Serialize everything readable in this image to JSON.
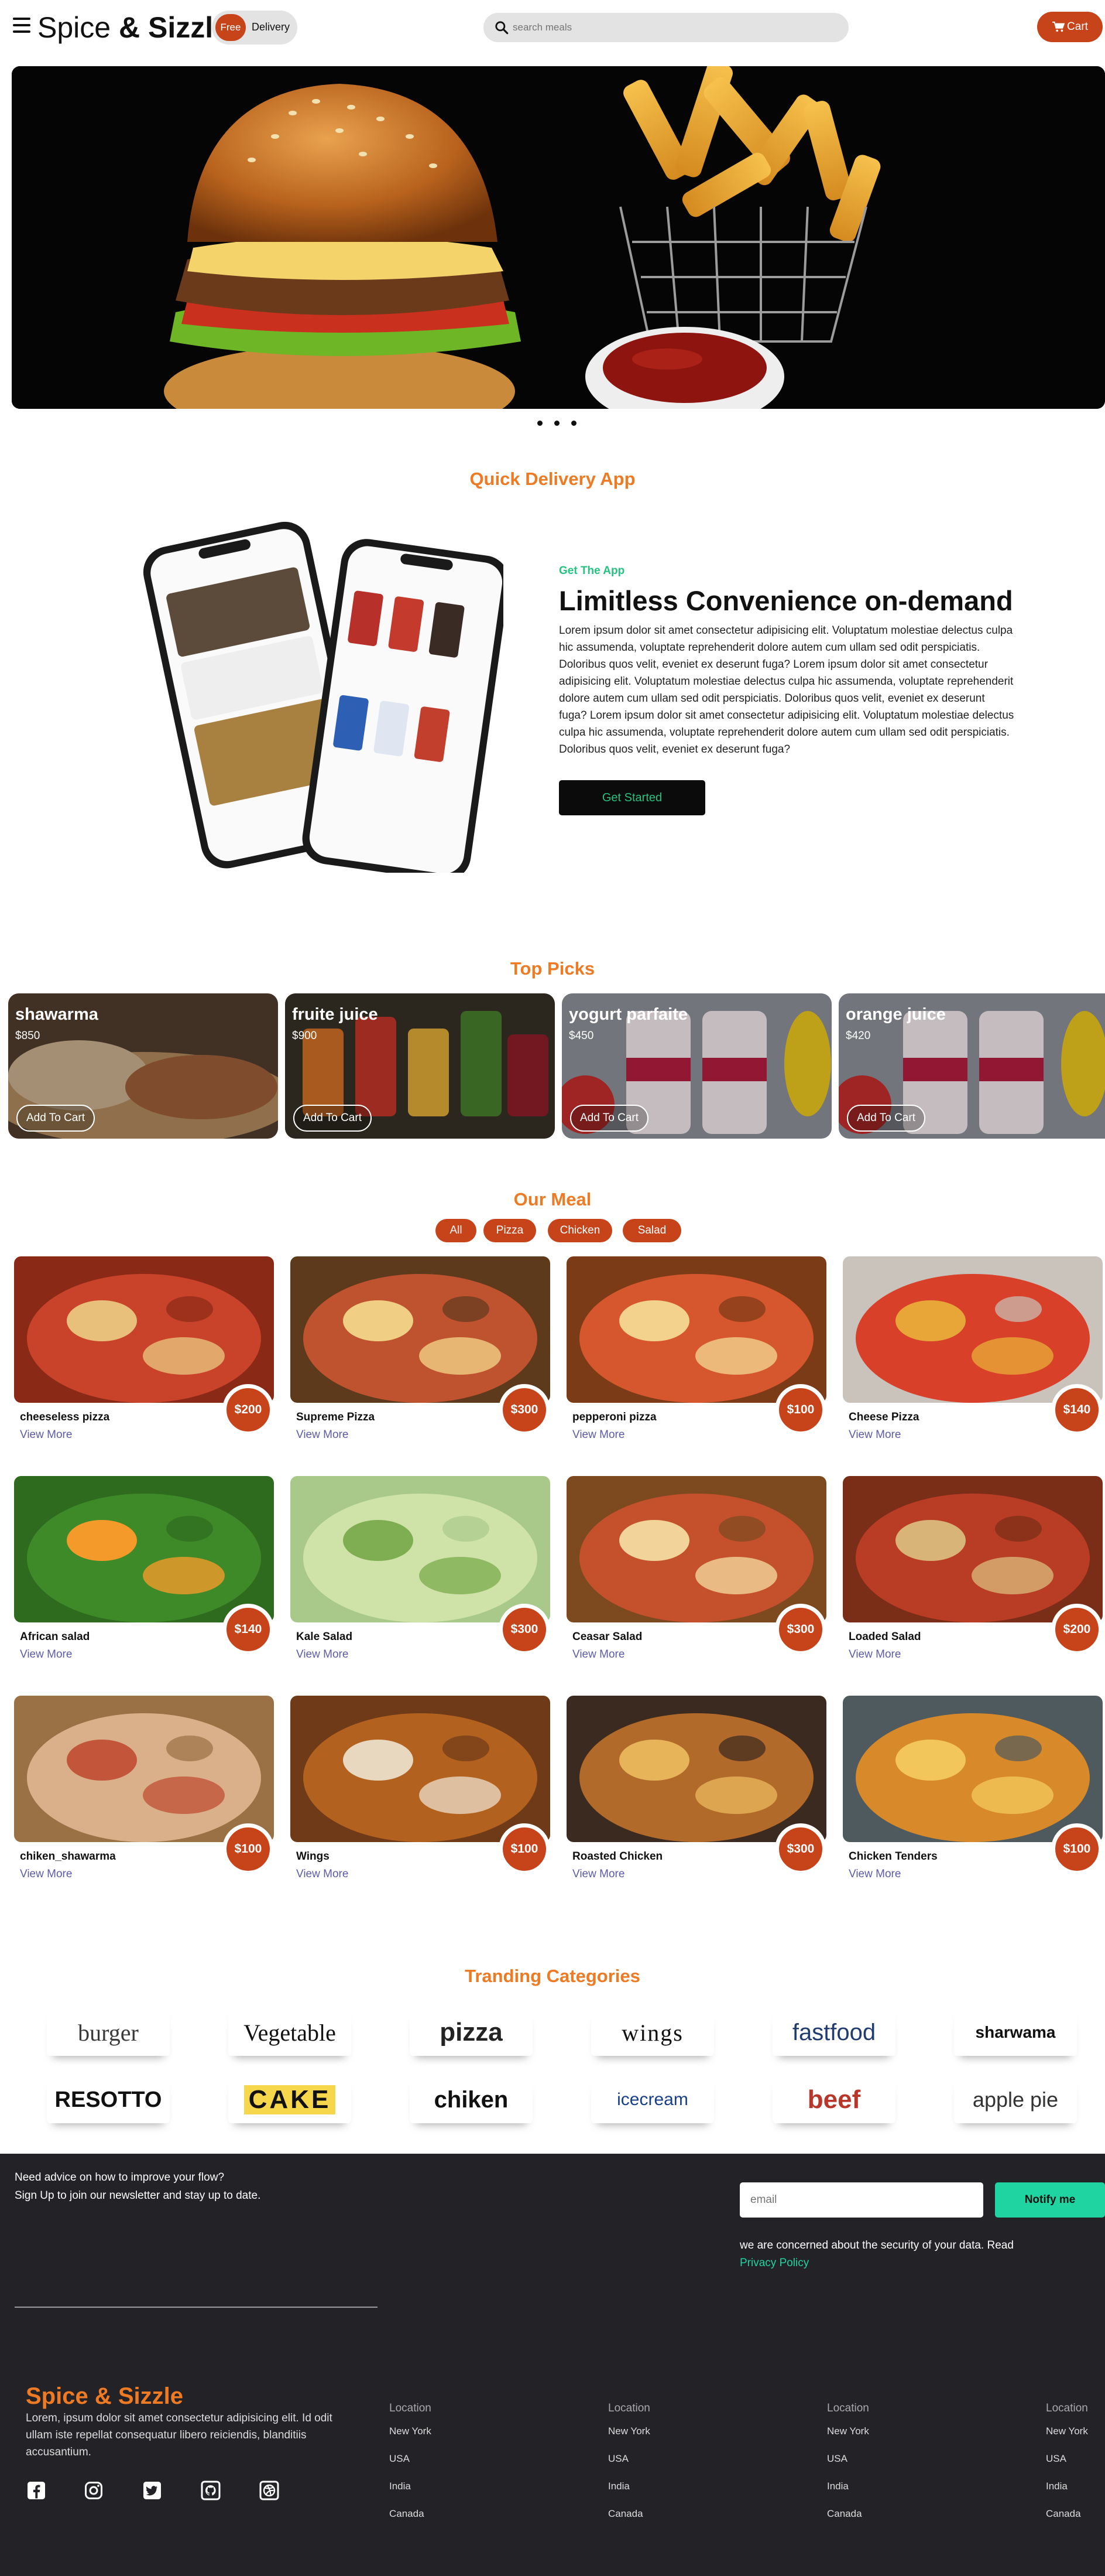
{
  "header": {
    "brand_part1": "Spice",
    "brand_amp": "&",
    "brand_part2": "Sizzle",
    "free_badge": "Free",
    "delivery_label": "Delivery",
    "search_placeholder": "search meals",
    "cart_label": "Cart"
  },
  "colors": {
    "accent": "#c7431a",
    "orange": "#ee7a23",
    "green": "#26c281",
    "footer_bg": "#222227",
    "teal": "#1fd4a0"
  },
  "hero": {
    "slides": 3,
    "active_slide": 1
  },
  "app_section": {
    "title": "Quick Delivery App",
    "eyebrow": "Get The App",
    "headline": "Limitless Convenience on-demand",
    "body": "Lorem ipsum dolor sit amet consectetur adipisicing elit. Voluptatum molestiae delectus culpa hic assumenda, voluptate reprehenderit dolore autem cum ullam sed odit perspiciatis. Doloribus quos velit, eveniet ex deserunt fuga? Lorem ipsum dolor sit amet consectetur adipisicing elit. Voluptatum molestiae delectus culpa hic assumenda, voluptate reprehenderit dolore autem cum ullam sed odit perspiciatis. Doloribus quos velit, eveniet ex deserunt fuga? Lorem ipsum dolor sit amet consectetur adipisicing elit. Voluptatum molestiae delectus culpa hic assumenda, voluptate reprehenderit dolore autem cum ullam sed odit perspiciatis. Doloribus quos velit, eveniet ex deserunt fuga?",
    "button": "Get Started"
  },
  "top_picks": {
    "title": "Top Picks",
    "button_label": "Add To Cart",
    "items": [
      {
        "name": "shawarma",
        "price": "$850"
      },
      {
        "name": "fruite juice",
        "price": "$900"
      },
      {
        "name": "yogurt parfaite",
        "price": "$450"
      },
      {
        "name": "orange juice",
        "price": "$420"
      }
    ]
  },
  "meals": {
    "title": "Our Meal",
    "filters": [
      "All",
      "Pizza",
      "Chicken",
      "Salad"
    ],
    "view_more": "View More",
    "items": [
      {
        "name": "cheeseless pizza",
        "price": "$200"
      },
      {
        "name": "Supreme Pizza",
        "price": "$300"
      },
      {
        "name": "pepperoni pizza",
        "price": "$100"
      },
      {
        "name": "Cheese Pizza",
        "price": "$140"
      },
      {
        "name": "African salad",
        "price": "$140"
      },
      {
        "name": "Kale Salad",
        "price": "$300"
      },
      {
        "name": "Ceasar Salad",
        "price": "$300"
      },
      {
        "name": "Loaded Salad",
        "price": "$200"
      },
      {
        "name": "chiken_shawarma",
        "price": "$100"
      },
      {
        "name": "Wings",
        "price": "$100"
      },
      {
        "name": "Roasted Chicken",
        "price": "$300"
      },
      {
        "name": "Chicken Tenders",
        "price": "$100"
      }
    ]
  },
  "categories": {
    "title": "Tranding Categories",
    "items": [
      "burger",
      "Vegetable",
      "pizza",
      "wings",
      "fastfood",
      "sharwama",
      "RESOTTO",
      "CAKE",
      "chiken",
      "icecream",
      "beef",
      "apple pie"
    ]
  },
  "footer": {
    "newsletter_line1": "Need advice on how to improve your flow?",
    "newsletter_line2": "Sign Up to join our newsletter and stay up to date.",
    "email_placeholder": "email",
    "notify_button": "Notify me",
    "privacy_text": "we are concerned about the security of your data. Read",
    "privacy_link": "Privacy Policy",
    "brand": "Spice & Sizzle",
    "description": "Lorem, ipsum dolor sit amet consectetur adipisicing elit. Id odit ullam iste repellat consequatur libero reiciendis, blanditiis accusantium.",
    "social": [
      "facebook-icon",
      "instagram-icon",
      "twitter-icon",
      "github-icon",
      "dribbble-icon"
    ],
    "location_columns": [
      {
        "heading": "Location",
        "items": [
          "New York",
          "USA",
          "India",
          "Canada"
        ]
      },
      {
        "heading": "Location",
        "items": [
          "New York",
          "USA",
          "India",
          "Canada"
        ]
      },
      {
        "heading": "Location",
        "items": [
          "New York",
          "USA",
          "India",
          "Canada"
        ]
      },
      {
        "heading": "Location",
        "items": [
          "New York",
          "USA",
          "India",
          "Canada"
        ]
      }
    ]
  }
}
